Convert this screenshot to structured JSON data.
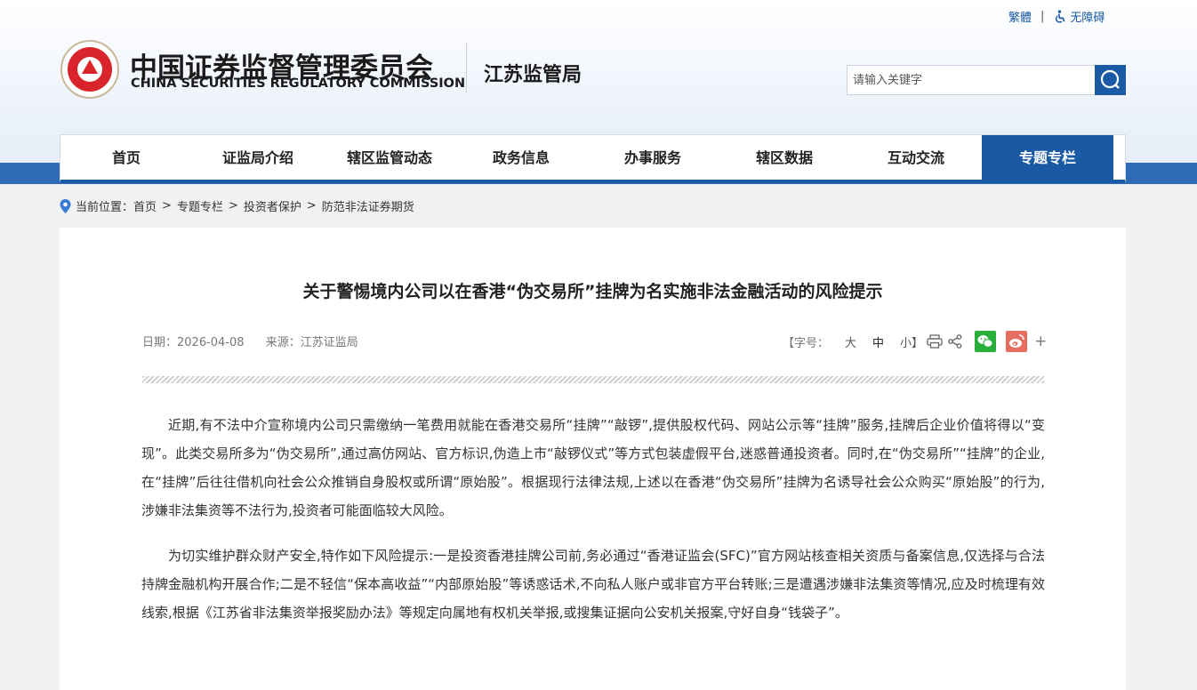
{
  "header": {
    "lang_switch": "繁體",
    "accessibility": "无障碍",
    "org_name_cn": "中国证券监督管理委员会",
    "org_name_en": "CHINA SECURITIES REGULATORY COMMISSION",
    "bureau": "江苏监管局",
    "search": {
      "placeholder": "请输入关键字"
    }
  },
  "nav": [
    {
      "label": "首页"
    },
    {
      "label": "证监局介绍"
    },
    {
      "label": "辖区监管动态"
    },
    {
      "label": "政务信息"
    },
    {
      "label": "办事服务"
    },
    {
      "label": "辖区数据"
    },
    {
      "label": "互动交流"
    },
    {
      "label": "专题专栏",
      "active": true
    }
  ],
  "breadcrumb": {
    "prefix": "当前位置：",
    "items": [
      "首页",
      "专题专栏",
      "投资者保护",
      "防范非法证券期货"
    ]
  },
  "article": {
    "title": "关于警惕境内公司以在香港“伪交易所”挂牌为名实施非法金融活动的风险提示",
    "date": "日期：2026-04-08",
    "source": "来源：江苏证监局",
    "font_size_label": "【字号：",
    "font_sizes": [
      "大",
      "中",
      "小】"
    ],
    "paragraphs": [
      "近期,有不法中介宣称境内公司只需缴纳一笔费用就能在香港交易所“挂牌”“敲锣”,提供股权代码、网站公示等“挂牌”服务,挂牌后企业价值将得以“变现”。此类交易所多为“伪交易所”,通过高仿网站、官方标识,伪造上市“敲锣仪式”等方式包装虚假平台,迷惑普通投资者。同时,在“伪交易所”“挂牌”的企业,在“挂牌”后往往借机向社会公众推销自身股权或所谓“原始股”。根据现行法律法规,上述以在香港“伪交易所”挂牌为名诱导社会公众购买“原始股”的行为,涉嫌非法集资等不法行为,投资者可能面临较大风险。",
      "为切实维护群众财产安全,特作如下风险提示:一是投资香港挂牌公司前,务必通过“香港证监会(SFC)”官方网站核查相关资质与备案信息,仅选择与合法持牌金融机构开展合作;二是不轻信“保本高收益”“内部原始股”等诱惑话术,不向私人账户或非官方平台转账;三是遭遇涉嫌非法集资等情况,应及时梳理有效线索,根据《江苏省非法集资举报奖励办法》等规定向属地有权机关举报,或搜集证据向公安机关报案,守好自身“钱袋子”。"
    ]
  },
  "colors": {
    "brand": "#1a5aa5",
    "wechat": "#2aae3b",
    "weibo": "#e66e5f",
    "logo_red": "#d9242b"
  },
  "icons": [
    "location-icon",
    "accessibility-icon",
    "search-icon",
    "print-icon",
    "share-icon",
    "wechat-icon",
    "weibo-icon",
    "plus-icon"
  ]
}
